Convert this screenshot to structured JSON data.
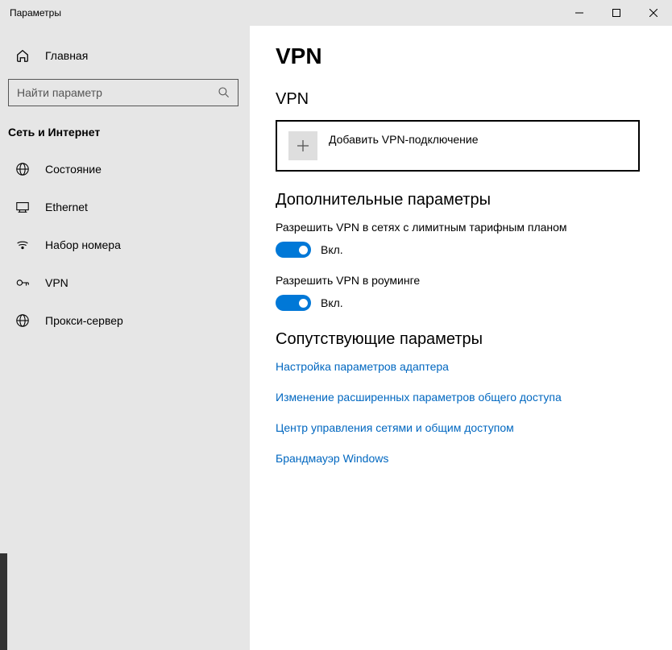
{
  "titlebar": {
    "title": "Параметры"
  },
  "sidebar": {
    "home": "Главная",
    "search_placeholder": "Найти параметр",
    "category": "Сеть и Интернет",
    "items": [
      {
        "label": "Состояние"
      },
      {
        "label": "Ethernet"
      },
      {
        "label": "Набор номера"
      },
      {
        "label": "VPN"
      },
      {
        "label": "Прокси-сервер"
      }
    ]
  },
  "main": {
    "title": "VPN",
    "section_vpn": "VPN",
    "add_vpn": "Добавить VPN-подключение",
    "section_advanced": "Дополнительные параметры",
    "metered_label": "Разрешить VPN в сетях с лимитным тарифным планом",
    "metered_state": "Вкл.",
    "roaming_label": "Разрешить VPN в роуминге",
    "roaming_state": "Вкл.",
    "section_related": "Сопутствующие параметры",
    "links": [
      "Настройка параметров адаптера",
      "Изменение расширенных параметров общего доступа",
      "Центр управления сетями и общим доступом",
      "Брандмауэр Windows"
    ]
  }
}
